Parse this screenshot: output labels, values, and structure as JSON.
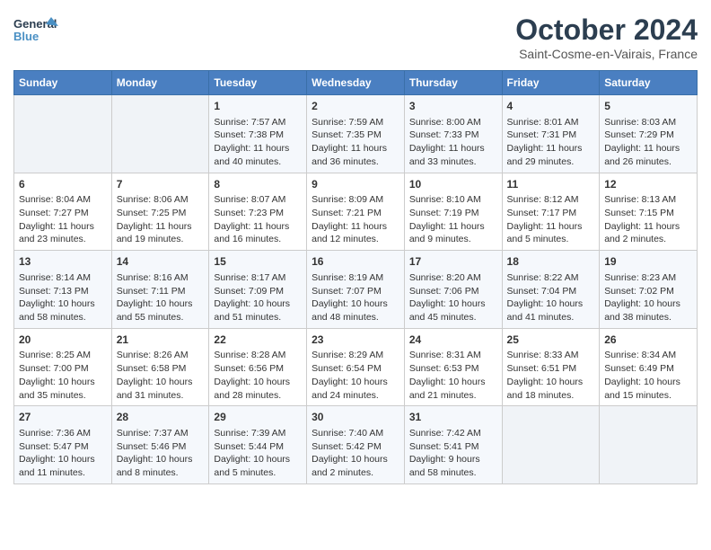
{
  "header": {
    "logo_line1": "General",
    "logo_line2": "Blue",
    "month": "October 2024",
    "location": "Saint-Cosme-en-Vairais, France"
  },
  "days_of_week": [
    "Sunday",
    "Monday",
    "Tuesday",
    "Wednesday",
    "Thursday",
    "Friday",
    "Saturday"
  ],
  "weeks": [
    [
      {
        "num": "",
        "empty": true
      },
      {
        "num": "",
        "empty": true
      },
      {
        "num": "1",
        "sunrise": "7:57 AM",
        "sunset": "7:38 PM",
        "daylight": "11 hours and 40 minutes."
      },
      {
        "num": "2",
        "sunrise": "7:59 AM",
        "sunset": "7:35 PM",
        "daylight": "11 hours and 36 minutes."
      },
      {
        "num": "3",
        "sunrise": "8:00 AM",
        "sunset": "7:33 PM",
        "daylight": "11 hours and 33 minutes."
      },
      {
        "num": "4",
        "sunrise": "8:01 AM",
        "sunset": "7:31 PM",
        "daylight": "11 hours and 29 minutes."
      },
      {
        "num": "5",
        "sunrise": "8:03 AM",
        "sunset": "7:29 PM",
        "daylight": "11 hours and 26 minutes."
      }
    ],
    [
      {
        "num": "6",
        "sunrise": "8:04 AM",
        "sunset": "7:27 PM",
        "daylight": "11 hours and 23 minutes."
      },
      {
        "num": "7",
        "sunrise": "8:06 AM",
        "sunset": "7:25 PM",
        "daylight": "11 hours and 19 minutes."
      },
      {
        "num": "8",
        "sunrise": "8:07 AM",
        "sunset": "7:23 PM",
        "daylight": "11 hours and 16 minutes."
      },
      {
        "num": "9",
        "sunrise": "8:09 AM",
        "sunset": "7:21 PM",
        "daylight": "11 hours and 12 minutes."
      },
      {
        "num": "10",
        "sunrise": "8:10 AM",
        "sunset": "7:19 PM",
        "daylight": "11 hours and 9 minutes."
      },
      {
        "num": "11",
        "sunrise": "8:12 AM",
        "sunset": "7:17 PM",
        "daylight": "11 hours and 5 minutes."
      },
      {
        "num": "12",
        "sunrise": "8:13 AM",
        "sunset": "7:15 PM",
        "daylight": "11 hours and 2 minutes."
      }
    ],
    [
      {
        "num": "13",
        "sunrise": "8:14 AM",
        "sunset": "7:13 PM",
        "daylight": "10 hours and 58 minutes."
      },
      {
        "num": "14",
        "sunrise": "8:16 AM",
        "sunset": "7:11 PM",
        "daylight": "10 hours and 55 minutes."
      },
      {
        "num": "15",
        "sunrise": "8:17 AM",
        "sunset": "7:09 PM",
        "daylight": "10 hours and 51 minutes."
      },
      {
        "num": "16",
        "sunrise": "8:19 AM",
        "sunset": "7:07 PM",
        "daylight": "10 hours and 48 minutes."
      },
      {
        "num": "17",
        "sunrise": "8:20 AM",
        "sunset": "7:06 PM",
        "daylight": "10 hours and 45 minutes."
      },
      {
        "num": "18",
        "sunrise": "8:22 AM",
        "sunset": "7:04 PM",
        "daylight": "10 hours and 41 minutes."
      },
      {
        "num": "19",
        "sunrise": "8:23 AM",
        "sunset": "7:02 PM",
        "daylight": "10 hours and 38 minutes."
      }
    ],
    [
      {
        "num": "20",
        "sunrise": "8:25 AM",
        "sunset": "7:00 PM",
        "daylight": "10 hours and 35 minutes."
      },
      {
        "num": "21",
        "sunrise": "8:26 AM",
        "sunset": "6:58 PM",
        "daylight": "10 hours and 31 minutes."
      },
      {
        "num": "22",
        "sunrise": "8:28 AM",
        "sunset": "6:56 PM",
        "daylight": "10 hours and 28 minutes."
      },
      {
        "num": "23",
        "sunrise": "8:29 AM",
        "sunset": "6:54 PM",
        "daylight": "10 hours and 24 minutes."
      },
      {
        "num": "24",
        "sunrise": "8:31 AM",
        "sunset": "6:53 PM",
        "daylight": "10 hours and 21 minutes."
      },
      {
        "num": "25",
        "sunrise": "8:33 AM",
        "sunset": "6:51 PM",
        "daylight": "10 hours and 18 minutes."
      },
      {
        "num": "26",
        "sunrise": "8:34 AM",
        "sunset": "6:49 PM",
        "daylight": "10 hours and 15 minutes."
      }
    ],
    [
      {
        "num": "27",
        "sunrise": "7:36 AM",
        "sunset": "5:47 PM",
        "daylight": "10 hours and 11 minutes."
      },
      {
        "num": "28",
        "sunrise": "7:37 AM",
        "sunset": "5:46 PM",
        "daylight": "10 hours and 8 minutes."
      },
      {
        "num": "29",
        "sunrise": "7:39 AM",
        "sunset": "5:44 PM",
        "daylight": "10 hours and 5 minutes."
      },
      {
        "num": "30",
        "sunrise": "7:40 AM",
        "sunset": "5:42 PM",
        "daylight": "10 hours and 2 minutes."
      },
      {
        "num": "31",
        "sunrise": "7:42 AM",
        "sunset": "5:41 PM",
        "daylight": "9 hours and 58 minutes."
      },
      {
        "num": "",
        "empty": true
      },
      {
        "num": "",
        "empty": true
      }
    ]
  ]
}
